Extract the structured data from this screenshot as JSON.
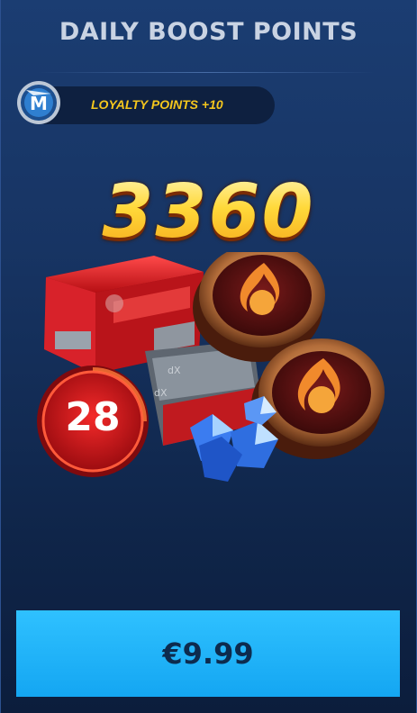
{
  "header": {
    "title": "DAILY BOOST POINTS"
  },
  "loyalty": {
    "label": "LOYALTY POINTS +10",
    "icon": "m-emblem-icon"
  },
  "offer": {
    "amount": "3360",
    "items_count": "28",
    "items": [
      "red-crate-icon",
      "flame-coin-icon",
      "blue-crystal-icon",
      "card-pack-icon"
    ]
  },
  "purchase": {
    "price": "€9.99"
  },
  "colors": {
    "background": "#173463",
    "gold": "#ffd233",
    "loyalty_text": "#f4c61d",
    "button": "#1fb3f8",
    "badge": "#d8141b"
  }
}
